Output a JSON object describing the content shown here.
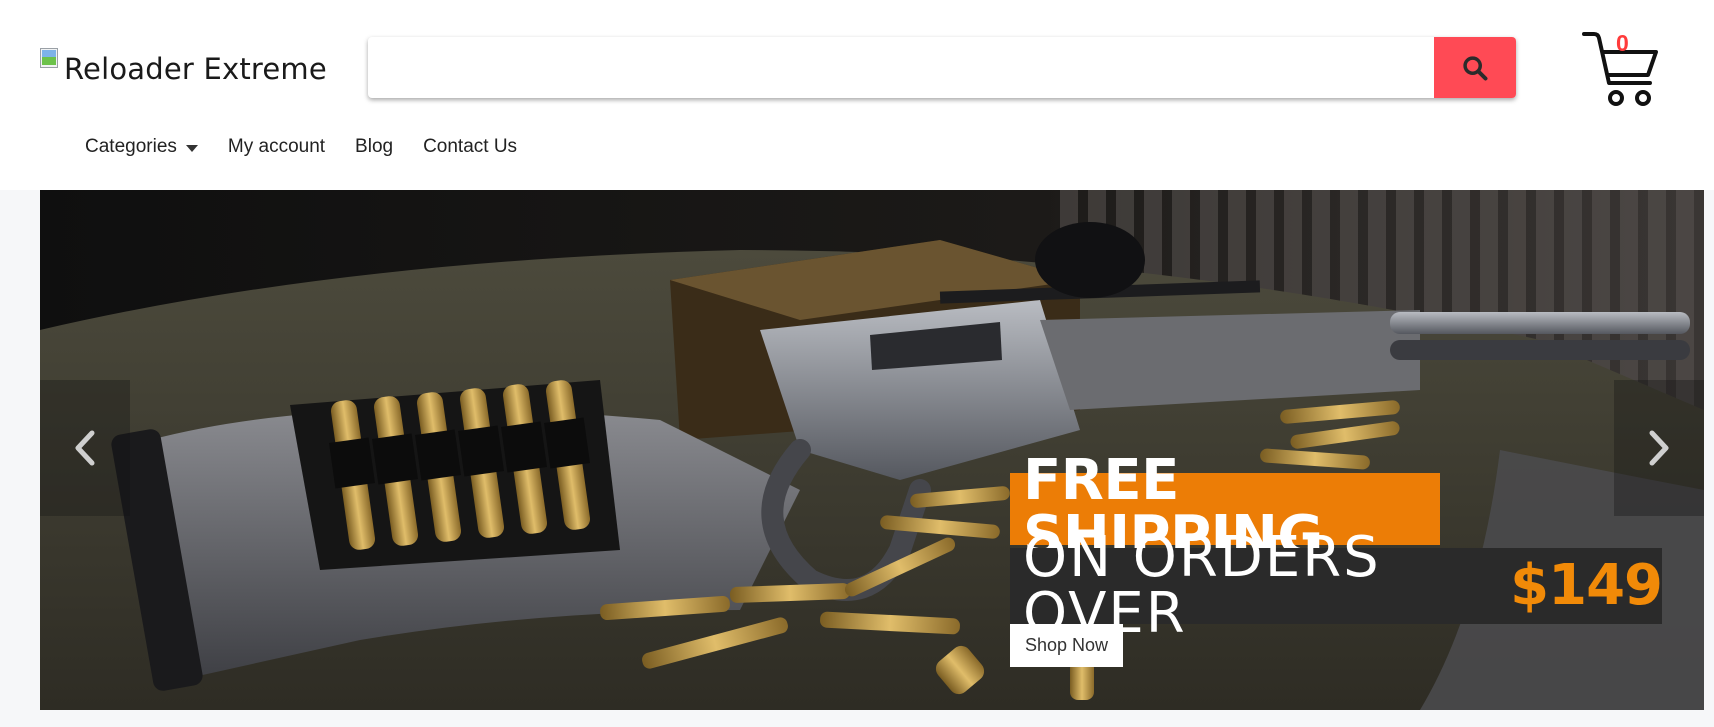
{
  "header": {
    "logo_alt": "Reloader Extreme",
    "search": {
      "value": "",
      "placeholder": "",
      "button_icon": "search-icon"
    },
    "cart": {
      "count": "0",
      "icon": "cart-icon"
    }
  },
  "nav": {
    "items": [
      {
        "label": "Categories",
        "has_dropdown": true
      },
      {
        "label": "My account"
      },
      {
        "label": "Blog"
      },
      {
        "label": "Contact Us"
      }
    ]
  },
  "slider": {
    "promo_line1": "FREE SHIPPING",
    "promo_line2": "ON ORDERS OVER",
    "promo_amount": "$149",
    "cta_label": "Shop Now",
    "prev_icon": "chevron-left-icon",
    "next_icon": "chevron-right-icon"
  },
  "colors": {
    "search_button": "#ff4a55",
    "cart_count": "#ff3b3b",
    "promo_orange": "#ec7d06",
    "promo_dark": "#2a2a2a"
  }
}
